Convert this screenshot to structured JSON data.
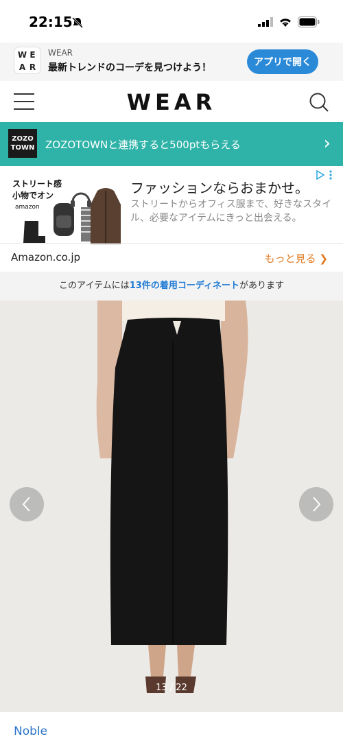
{
  "status": {
    "time": "22:15"
  },
  "app_banner": {
    "logo_letters": [
      "W",
      "E",
      "A",
      "R"
    ],
    "name": "WEAR",
    "tagline": "最新トレンドのコーデを見つけよう！",
    "open_label": "アプリで開く"
  },
  "nav": {
    "logo": "WEAR"
  },
  "zozo": {
    "logo_line1": "ZOZO",
    "logo_line2": "TOWN",
    "text": "ZOZOTOWNと連携すると500ptもらえる"
  },
  "ad": {
    "badge_line1": "ストリート感",
    "badge_line2": "小物でオン",
    "badge_brand": "amazon",
    "headline": "ファッションならおまかせ。",
    "body": "ストリートからオフィス服まで、好きなスタイル、必要なアイテムにきっと出会える。",
    "domain": "Amazon.co.jp",
    "more_label": "もっと見る ❯"
  },
  "notice": {
    "prefix": "このアイテムには",
    "highlight": "13件の着用コーディネート",
    "suffix": "があります"
  },
  "carousel": {
    "counter": "13 / 22"
  },
  "item": {
    "brand": "Noble"
  },
  "colors": {
    "teal": "#2fb3a8",
    "blue": "#2b8ad8",
    "orange": "#e07a1f"
  }
}
